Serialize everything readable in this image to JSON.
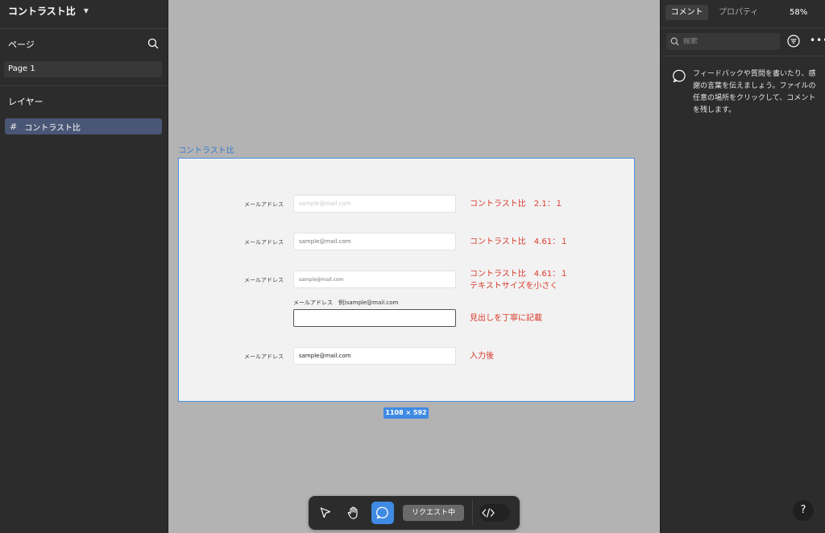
{
  "file": {
    "title": "コントラスト比"
  },
  "left": {
    "pages_label": "ページ",
    "page_item": "Page 1",
    "layers_label": "レイヤー",
    "layer_item": "コントラスト比"
  },
  "canvas": {
    "frame_label": "コントラスト比",
    "size_badge": "1108 × 592",
    "rows": [
      {
        "label": "メールアドレス",
        "placeholder": "sample@mail.com",
        "annotation": "コントラスト比　2.1：１"
      },
      {
        "label": "メールアドレス",
        "placeholder": "sample@mail.com",
        "annotation": "コントラスト比　4.61：１"
      },
      {
        "label": "メールアドレス",
        "placeholder": "sample@mail.com",
        "annotation_line1": "コントラスト比　4.61：１",
        "annotation_line2": "テキストサイズを小さく"
      },
      {
        "label_above": "メールアドレス　例)sample@mail.com",
        "annotation": "見出しを丁寧に記載"
      },
      {
        "label": "メールアドレス",
        "value": "sample@mail.com",
        "annotation": "入力後"
      }
    ]
  },
  "right": {
    "tab_comment": "コメント",
    "tab_properties": "プロパティ",
    "zoom": "58%",
    "search_placeholder": "検索",
    "hint_text": "フィードバックや質問を書いたり、感謝の言葉を伝えましょう。ファイルの任意の場所をクリックして、コメントを残します。",
    "help": "?"
  },
  "toolbar": {
    "request_label": "リクエスト中"
  },
  "colors": {
    "accent": "#3f8ae2",
    "annotation_red": "#d93a2b",
    "panel_bg": "#2c2c2c",
    "canvas_bg": "#b3b3b3",
    "selected_layer": "#4a5675"
  },
  "icons": [
    "chevron-down-icon",
    "search-icon",
    "frame-hash-icon",
    "filter-icon",
    "more-icon",
    "comment-bubble-icon",
    "help-icon",
    "pointer-icon",
    "hand-icon",
    "code-icon"
  ]
}
